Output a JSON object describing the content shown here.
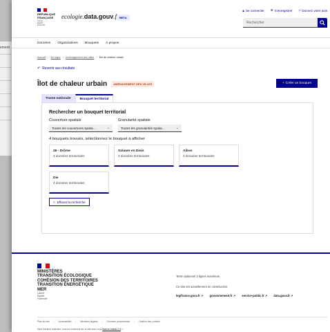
{
  "background": {
    "fragment": "ement"
  },
  "header": {
    "republic": [
      "RÉPUBLIQUE",
      "FRANÇAISE"
    ],
    "motto": [
      "Liberté",
      "Égalité",
      "Fraternité"
    ],
    "brand_prefix": "ecologie.",
    "brand_bold": "data.gouv",
    "brand_suffix": ".fr",
    "beta": "BETA",
    "links": [
      "Se connecter",
      "S'enregistrer",
      "Donnez votre avis"
    ],
    "search_placeholder": "Rechercher"
  },
  "nav": [
    "Données",
    "Organizations",
    "Bouquets",
    "À propos"
  ],
  "breadcrumb": [
    "Accueil",
    "Se loger",
    "Aménagement des villes",
    "Îlot de chaleur urbain"
  ],
  "back": "Revenir aux résultats",
  "title": "Îlot de chaleur urbain",
  "tag": "AMÉNAGEMENT DES VILLES",
  "create_button": "Créer un bouquet",
  "tabs": [
    "Trame nationale",
    "Bouquet territorial"
  ],
  "panel": {
    "heading": "Rechercher un bouquet territorial",
    "filter1_label": "Couverture spatiale",
    "filter1_value": "Toutes les couvertures spatia…",
    "filter2_label": "Granularité spatiale",
    "filter2_value": "Toutes les granularités spatia…",
    "found": "4 bouquets trouvés, sélectionnez le bouquet à afficher",
    "cards": [
      {
        "name": "26 - Drôme",
        "count": "4 données territoriales"
      },
      {
        "name": "Solaure en Diois",
        "count": "4 données territoriales"
      },
      {
        "name": "Aibon",
        "count": "4 données territoriales"
      },
      {
        "name": "Die",
        "count": "4 données territoriales"
      }
    ],
    "clear": "Effacer la recherche"
  },
  "footer": {
    "ministry": [
      "MINISTÈRES",
      "TRANSITION ÉCOLOGIQUE",
      "COHÉSION DES TERRITOIRES",
      "TRANSITION ÉNERGÉTIQUE",
      "MER"
    ],
    "motto": [
      "Liberté",
      "Égalité",
      "Fraternité"
    ],
    "desc": "Texte optionnel 3 lignes maximum.",
    "desc2": "Ce site est actuellement en construction",
    "links": [
      "legifrance.gouv.fr",
      "gouvernement.fr",
      "service-public.fr",
      "data.gouv.fr"
    ],
    "bottom": [
      "Plan du site",
      "Accessibilité",
      "Mentions légales",
      "Données personnelles",
      "Gestion des cookies"
    ],
    "license_prefix": "Sauf mention contraire, tous les contenus de ce site sont sous",
    "license_link": "licence etalab-2.0"
  },
  "colors": {
    "primary": "#000091",
    "tag_bg": "#fee9e5",
    "tag_text": "#b34000",
    "flag_blue": "#000091",
    "flag_red": "#e1000f"
  }
}
